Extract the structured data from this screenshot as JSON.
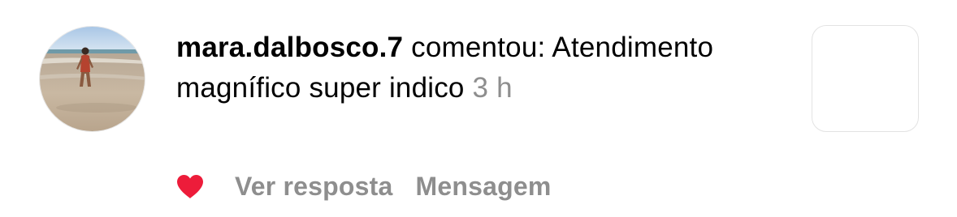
{
  "notification": {
    "username": "mara.dalbosco.7",
    "action_text": "comentou:",
    "comment_text": "Atendimento magnífico super indico",
    "time": "3 h",
    "avatar_icon": "beach-photo-avatar",
    "liked": true,
    "heart_color": "#ed1c3a"
  },
  "actions": {
    "reply_label": "Ver resposta",
    "message_label": "Mensagem"
  }
}
